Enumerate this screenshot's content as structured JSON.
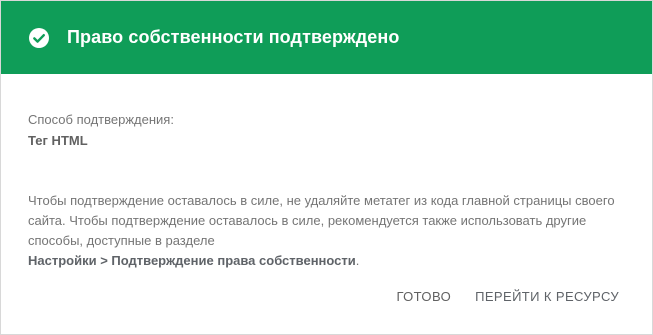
{
  "header": {
    "title": "Право собственности подтверждено",
    "icon": "check-circle-icon",
    "background_color": "#0f9d58"
  },
  "verification": {
    "method_label": "Способ подтверждения:",
    "method_value": "Тег HTML"
  },
  "notice": {
    "text": "Чтобы подтверждение оставалось в силе, не удаляйте метатег из кода главной страницы своего сайта. Чтобы подтверждение оставалось в силе, рекомендуется также использовать другие способы, доступные в разделе",
    "settings_path": "Настройки > Подтверждение права собственности",
    "trailing": "."
  },
  "actions": {
    "done_label": "ГОТОВО",
    "go_to_resource_label": "ПЕРЕЙТИ К РЕСУРСУ"
  }
}
